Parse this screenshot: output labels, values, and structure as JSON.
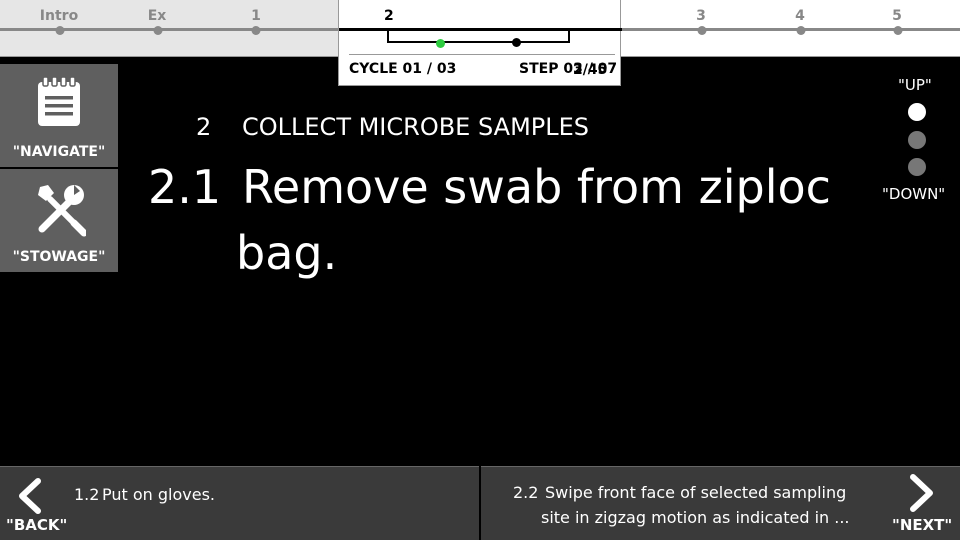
{
  "progress": {
    "ticks": [
      {
        "label": "Intro"
      },
      {
        "label": "Ex"
      },
      {
        "label": "1"
      },
      {
        "label": "2"
      },
      {
        "label": "3"
      },
      {
        "label": "4"
      },
      {
        "label": "5"
      }
    ],
    "current_section": "2",
    "cycle": "CYCLE 01 / 03",
    "step": "STEP 03 / 07",
    "step_overlay": "2/45"
  },
  "sidebar": {
    "navigate_label": "\"NAVIGATE\"",
    "stowage_label": "\"STOWAGE\""
  },
  "procedure": {
    "section_number": "2",
    "section_title": "COLLECT MICROBE SAMPLES",
    "step_number": "2.1",
    "step_text_line1": "Remove swab from ziploc",
    "step_text_line2": "bag."
  },
  "scroll_hint": {
    "up_label": "\"UP\"",
    "down_label": "\"DOWN\""
  },
  "footer": {
    "back_label": "\"BACK\"",
    "next_label": "\"NEXT\"",
    "prev_step_number": "1.2",
    "prev_step_text": "Put on gloves.",
    "next_step_number": "2.2",
    "next_step_text_line1": "Swipe front face of selected sampling",
    "next_step_text_line2": "site in zigzag motion as indicated in ..."
  },
  "colors": {
    "background": "#000000",
    "panel": "#5f5f5f",
    "footer": "#3a3a3a",
    "progress_done": "#2ecc40"
  }
}
